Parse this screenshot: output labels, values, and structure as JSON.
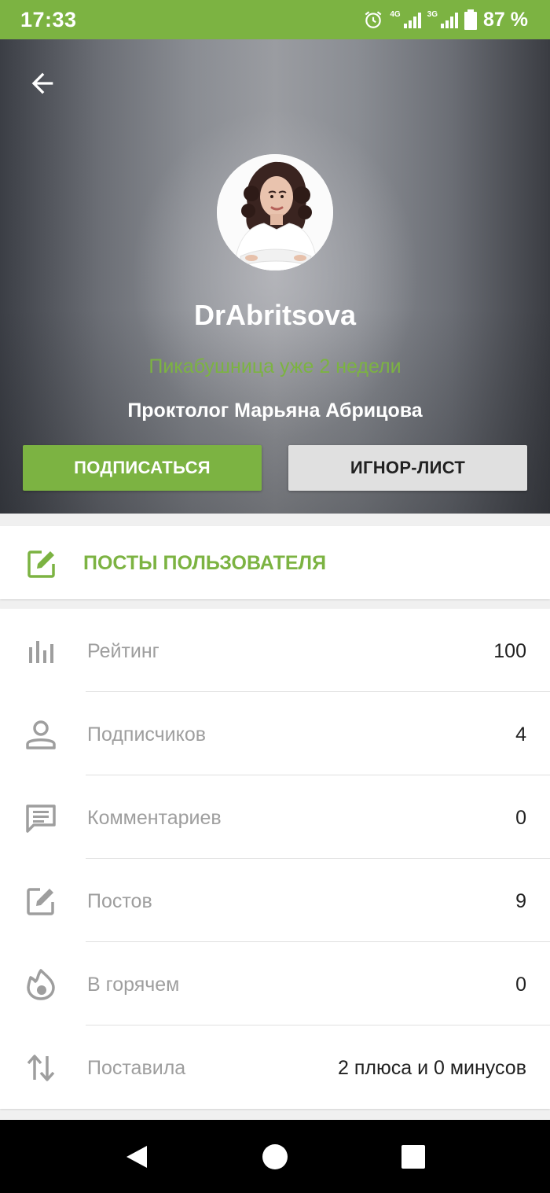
{
  "status_bar": {
    "time": "17:33",
    "battery": "87 %",
    "net1": "4G",
    "net2": "3G"
  },
  "profile": {
    "username": "DrAbritsova",
    "tenure": "Пикабушница уже 2 недели",
    "full_name": "Проктолог Марьяна Абрицова",
    "subscribe_label": "ПОДПИСАТЬСЯ",
    "ignore_label": "ИГНОР-ЛИСТ"
  },
  "posts_link": {
    "label": "ПОСТЫ ПОЛЬЗОВАТЕЛЯ"
  },
  "stats": [
    {
      "icon": "bar-chart-icon",
      "label": "Рейтинг",
      "value": "100"
    },
    {
      "icon": "person-icon",
      "label": "Подписчиков",
      "value": "4"
    },
    {
      "icon": "comment-icon",
      "label": "Комментариев",
      "value": "0"
    },
    {
      "icon": "edit-icon",
      "label": "Постов",
      "value": "9"
    },
    {
      "icon": "fire-icon",
      "label": "В горячем",
      "value": "0"
    },
    {
      "icon": "swap-vertical-icon",
      "label": "Поставила",
      "value": "2 плюса и 0 минусов"
    }
  ],
  "colors": {
    "accent": "#7cb342",
    "text_primary": "#212121",
    "text_secondary": "#9e9e9e"
  }
}
